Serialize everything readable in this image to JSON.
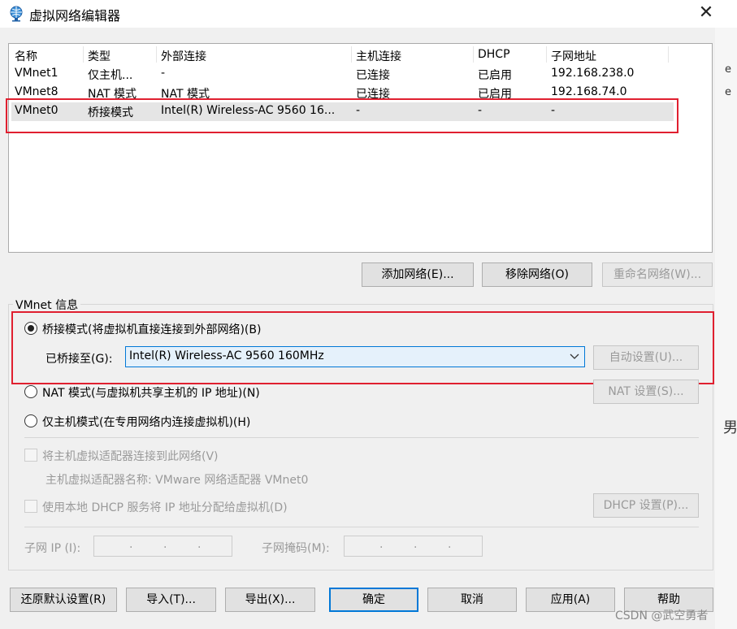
{
  "window": {
    "title": "虚拟网络编辑器",
    "close_glyph": "✕"
  },
  "table": {
    "headers": [
      "名称",
      "类型",
      "外部连接",
      "主机连接",
      "DHCP",
      "子网地址"
    ],
    "rows": [
      [
        "VMnet1",
        "仅主机...",
        "-",
        "已连接",
        "已启用",
        "192.168.238.0"
      ],
      [
        "VMnet8",
        "NAT 模式",
        "NAT 模式",
        "已连接",
        "已启用",
        "192.168.74.0"
      ],
      [
        "VMnet0",
        "桥接模式",
        "Intel(R) Wireless-AC 9560 16...",
        "-",
        "-",
        "-"
      ]
    ],
    "selected_row": 2
  },
  "list_buttons": {
    "add": "添加网络(E)...",
    "remove": "移除网络(O)",
    "rename": "重命名网络(W)..."
  },
  "vmnet_info": {
    "group_title": "VMnet 信息",
    "bridged_label": "桥接模式(将虚拟机直接连接到外部网络)(B)",
    "bridged_to_label": "已桥接至(G):",
    "bridged_to_value": "Intel(R) Wireless-AC 9560 160MHz",
    "auto_settings": "自动设置(U)...",
    "nat_label": "NAT 模式(与虚拟机共享主机的 IP 地址)(N)",
    "nat_settings": "NAT 设置(S)...",
    "hostonly_label": "仅主机模式(在专用网络内连接虚拟机)(H)",
    "connect_adapter_label": "将主机虚拟适配器连接到此网络(V)",
    "adapter_name_label": "主机虚拟适配器名称: VMware 网络适配器 VMnet0",
    "dhcp_label": "使用本地 DHCP 服务将 IP 地址分配给虚拟机(D)",
    "dhcp_settings": "DHCP 设置(P)...",
    "subnet_ip_label": "子网 IP (I):",
    "subnet_mask_label": "子网掩码(M):",
    "selected_mode": "bridged"
  },
  "footer": {
    "restore": "还原默认设置(R)",
    "import": "导入(T)...",
    "export": "导出(X)...",
    "ok": "确定",
    "cancel": "取消",
    "apply": "应用(A)",
    "help": "帮助"
  },
  "background": {
    "fragment_1": "e",
    "fragment_2": "e",
    "fragment_3": "男"
  },
  "watermark": "CSDN @武空勇者",
  "icons": {
    "title": "globe-network-icon",
    "dropdown": "chevron-down-icon"
  },
  "colors": {
    "highlight": "#e02030",
    "accent": "#0078d7",
    "selected_row": "#e5e5e5"
  }
}
